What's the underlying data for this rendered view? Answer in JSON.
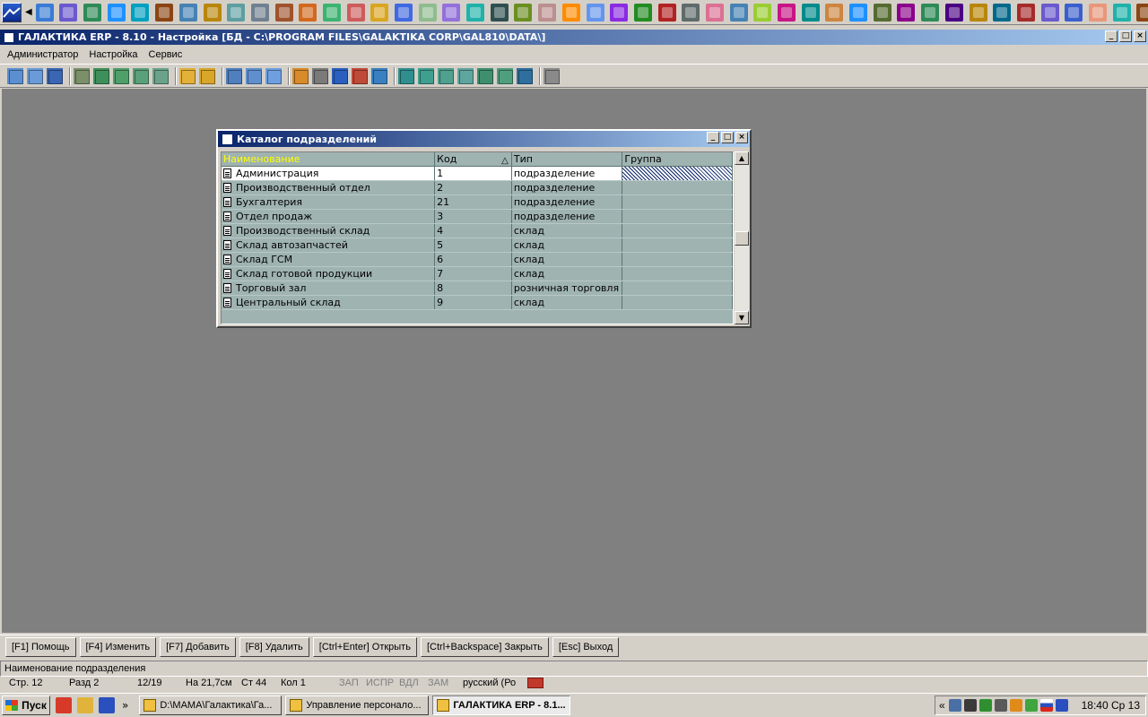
{
  "quickbar": {
    "icon_colors": [
      "#3a7bd5",
      "#6a5acd",
      "#2e8b57",
      "#1e90ff",
      "#00a0c0",
      "#8b4513",
      "#4682b4",
      "#b8860b",
      "#5f9ea0",
      "#708090",
      "#a0522d",
      "#d2691e",
      "#3cb371",
      "#cd5c5c",
      "#daa520",
      "#4169e1",
      "#8fbc8f",
      "#9370db",
      "#20b2aa",
      "#2f4f4f",
      "#6b8e23",
      "#bc8f8f",
      "#ff8c00",
      "#6495ed",
      "#8a2be2",
      "#228b22",
      "#b22222",
      "#5f6a6a",
      "#db7093",
      "#4682b4",
      "#9acd32",
      "#c71585",
      "#008b8b",
      "#cd853f",
      "#1e90ff",
      "#556b2f",
      "#8b008b",
      "#2e8b57",
      "#4b0082",
      "#b8860b",
      "#00688b",
      "#a52a2a",
      "#6a5acd",
      "#3a5fcd",
      "#e9967a",
      "#20b2aa",
      "#8b4513",
      "#ffa500"
    ]
  },
  "titlebar": {
    "title": "ГАЛАКТИКА ERP - 8.10 - Настройка [БД - C:\\PROGRAM FILES\\GALAKTIKA CORP\\GAL810\\DATA\\]",
    "btn_min": "_",
    "btn_max": "□",
    "btn_close": "×"
  },
  "menu": {
    "items": [
      "Администратор",
      "Настройка",
      "Сервис"
    ]
  },
  "dialog": {
    "title": "Каталог подразделений",
    "btn_min": "_",
    "btn_max": "□",
    "btn_close": "×",
    "columns": [
      "Наименование",
      "Код",
      "Тип",
      "Группа"
    ],
    "rows": [
      {
        "name": "Администрация",
        "code": "1",
        "type": "подразделение",
        "group": ""
      },
      {
        "name": "Производственный отдел",
        "code": "2",
        "type": "подразделение",
        "group": ""
      },
      {
        "name": "Бухгалтерия",
        "code": "21",
        "type": "подразделение",
        "group": ""
      },
      {
        "name": "Отдел продаж",
        "code": "3",
        "type": "подразделение",
        "group": ""
      },
      {
        "name": "Производственный склад",
        "code": "4",
        "type": "склад",
        "group": ""
      },
      {
        "name": "Склад автозапчастей",
        "code": "5",
        "type": "склад",
        "group": ""
      },
      {
        "name": "Склад ГСМ",
        "code": "6",
        "type": "склад",
        "group": ""
      },
      {
        "name": "Склад готовой продукции",
        "code": "7",
        "type": "склад",
        "group": ""
      },
      {
        "name": "Торговый зал",
        "code": "8",
        "type": "розничная торговля",
        "group": ""
      },
      {
        "name": "Центральный склад",
        "code": "9",
        "type": "склад",
        "group": ""
      }
    ]
  },
  "fkeys": [
    "[F1] Помощь",
    "[F4] Изменить",
    "[F7] Добавить",
    "[F8] Удалить",
    "[Ctrl+Enter] Открыть",
    "[Ctrl+Backspace] Закрыть",
    "[Esc] Выход"
  ],
  "hint": "Наименование подразделения",
  "status": {
    "page": "Стр. 12",
    "section": "Разд 2",
    "position": "12/19",
    "offset": "На 21,7см",
    "line": "Ст 44",
    "col": "Кол 1",
    "zap": "ЗАП",
    "ispr": "ИСПР",
    "vdl": "ВДЛ",
    "zam": "ЗАМ",
    "lang": "русский (Ро"
  },
  "taskbar": {
    "start": "Пуск",
    "overflow": "»",
    "tasks": [
      {
        "label": "D:\\МАМА\\Галактика\\Га...",
        "active": false
      },
      {
        "label": "Управление персонало...",
        "active": false
      },
      {
        "label": "ГАЛАКТИКА ERP - 8.1...",
        "active": true
      }
    ],
    "tray_expand": "«",
    "clock": "18:40 Ср 13"
  }
}
